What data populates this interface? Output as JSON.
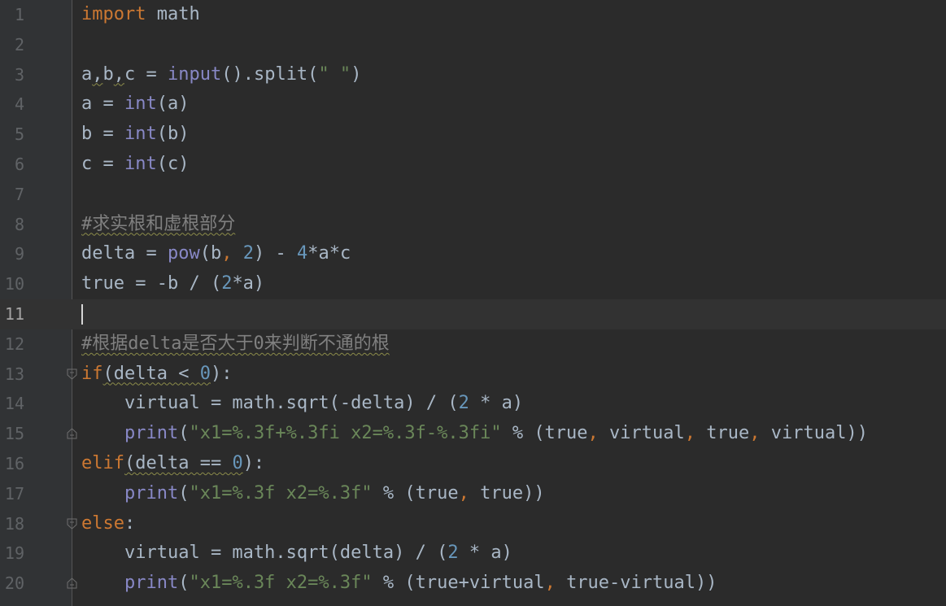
{
  "editor": {
    "language": "python",
    "current_line": 11,
    "colors": {
      "background": "#2b2b2b",
      "keyword": "#cc7832",
      "builtin": "#8888c6",
      "string": "#6a8759",
      "number": "#6897bb",
      "comment": "#808080",
      "identifier": "#a9b7c6"
    },
    "lines": [
      {
        "num": "1"
      },
      {
        "num": "2"
      },
      {
        "num": "3"
      },
      {
        "num": "4"
      },
      {
        "num": "5"
      },
      {
        "num": "6"
      },
      {
        "num": "7"
      },
      {
        "num": "8"
      },
      {
        "num": "9"
      },
      {
        "num": "10"
      },
      {
        "num": "11"
      },
      {
        "num": "12"
      },
      {
        "num": "13"
      },
      {
        "num": "14"
      },
      {
        "num": "15"
      },
      {
        "num": "16"
      },
      {
        "num": "17"
      },
      {
        "num": "18"
      },
      {
        "num": "19"
      },
      {
        "num": "20"
      }
    ],
    "tokens": {
      "l1": [
        "import",
        " math"
      ],
      "l3": [
        "a",
        ",",
        "b",
        ",",
        "c = ",
        "input",
        "().split(",
        "\" \"",
        ")"
      ],
      "l4": [
        "a = ",
        "int",
        "(a)"
      ],
      "l5": [
        "b = ",
        "int",
        "(b)"
      ],
      "l6": [
        "c = ",
        "int",
        "(c)"
      ],
      "l8": [
        "#求实根和虚根部分"
      ],
      "l9": [
        "delta = ",
        "pow",
        "(b",
        ", ",
        "2",
        ") - ",
        "4",
        "*a*c"
      ],
      "l10": [
        "true = -b / (",
        "2",
        "*a)"
      ],
      "l12": [
        "#根据delta是否大于0来判断不通的根"
      ],
      "l13": [
        "if",
        "(delta < ",
        "0",
        "):"
      ],
      "l14": [
        "    virtual = math.sqrt(-delta) / (",
        "2",
        " * a)"
      ],
      "l15": [
        "    ",
        "print",
        "(",
        "\"x1=%.3f+%.3fi x2=%.3f-%.3fi\"",
        " % (true",
        ", ",
        "virtual",
        ", ",
        "true",
        ", ",
        "virtual))"
      ],
      "l16": [
        "elif",
        "(delta == ",
        "0",
        "):"
      ],
      "l17": [
        "    ",
        "print",
        "(",
        "\"x1=%.3f x2=%.3f\"",
        " % (true",
        ", ",
        "true))"
      ],
      "l18": [
        "else",
        ":"
      ],
      "l19": [
        "    virtual = math.sqrt(delta) / (",
        "2",
        " * a)"
      ],
      "l20": [
        "    ",
        "print",
        "(",
        "\"x1=%.3f x2=%.3f\"",
        " % (true+virtual",
        ", ",
        "true-virtual))"
      ]
    }
  }
}
